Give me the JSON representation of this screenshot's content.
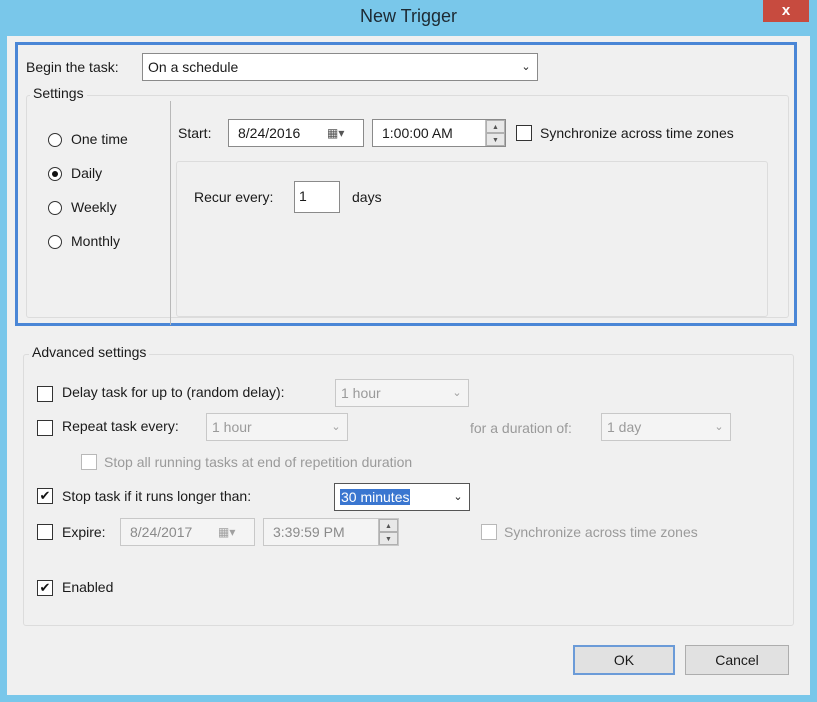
{
  "window": {
    "title": "New Trigger",
    "close_glyph": "x"
  },
  "begin": {
    "label": "Begin the task:",
    "value": "On a schedule"
  },
  "settings": {
    "group_label": "Settings",
    "radios": [
      {
        "label": "One time",
        "checked": false
      },
      {
        "label": "Daily",
        "checked": true
      },
      {
        "label": "Weekly",
        "checked": false
      },
      {
        "label": "Monthly",
        "checked": false
      }
    ],
    "start_label": "Start:",
    "start_date": "8/24/2016",
    "start_time": "1:00:00 AM",
    "sync_label": "Synchronize across time zones",
    "recur_label": "Recur every:",
    "recur_value": "1",
    "recur_unit": "days"
  },
  "advanced": {
    "group_label": "Advanced settings",
    "delay_label": "Delay task for up to (random delay):",
    "delay_value": "1 hour",
    "repeat_label": "Repeat task every:",
    "repeat_value": "1 hour",
    "duration_label": "for a duration of:",
    "duration_value": "1 day",
    "stop_all_label": "Stop all running tasks at end of repetition duration",
    "stop_longer_label": "Stop task if it runs longer than:",
    "stop_longer_value": "30 minutes",
    "expire_label": "Expire:",
    "expire_date": "8/24/2017",
    "expire_time": "3:39:59 PM",
    "expire_sync_label": "Synchronize across time zones",
    "enabled_label": "Enabled"
  },
  "buttons": {
    "ok": "OK",
    "cancel": "Cancel"
  },
  "glyphs": {
    "check": "✔",
    "chev": "⌄",
    "cal": "▦▾",
    "up": "▲",
    "down": "▼"
  },
  "colors": {
    "titlebar": "#79c7ea",
    "close": "#c74b3f",
    "focus": "#4a86d6",
    "selection": "#3a76d0"
  }
}
